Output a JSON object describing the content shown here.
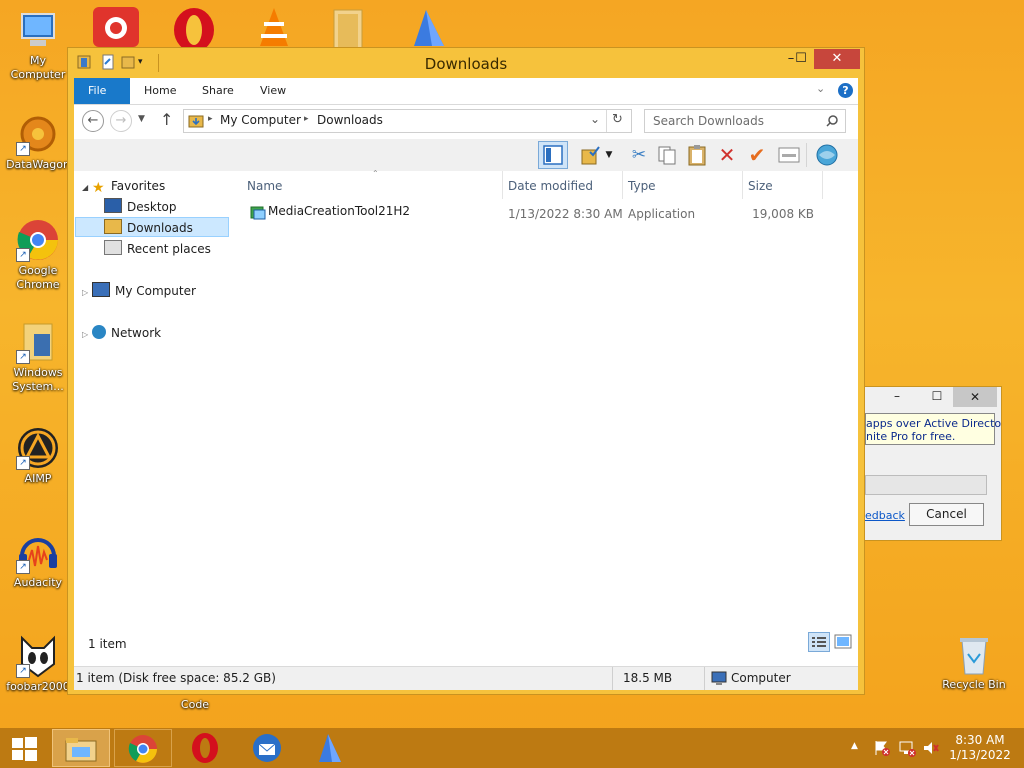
{
  "desktop": {
    "icons": [
      {
        "label": "My Computer",
        "icon": "my-computer-icon"
      },
      {
        "label": "DataWagon",
        "icon": "datawagon-icon"
      },
      {
        "label": "Google Chrome",
        "icon": "chrome-icon"
      },
      {
        "label": "Windows System...",
        "icon": "windows-system-icon"
      },
      {
        "label": "AIMP",
        "icon": "aimp-icon"
      },
      {
        "label": "Audacity",
        "icon": "audacity-icon"
      },
      {
        "label": "foobar2000",
        "icon": "foobar-icon"
      },
      {
        "label": "Code",
        "icon": "code-icon"
      },
      {
        "label": "Recycle Bin",
        "icon": "recycle-bin-icon"
      }
    ]
  },
  "window": {
    "title": "Downloads",
    "buttons": {
      "minimize": "–",
      "maximize": "☐",
      "close": "✕"
    },
    "ribbon": {
      "tabs": [
        "File",
        "Home",
        "Share",
        "View"
      ]
    },
    "address": {
      "segments": [
        "My Computer",
        "Downloads"
      ],
      "separator": "▸"
    },
    "search": {
      "placeholder": "Search Downloads"
    },
    "nav_pane": {
      "favorites": "Favorites",
      "desktop": "Desktop",
      "downloads": "Downloads",
      "recent": "Recent places",
      "computer": "My Computer",
      "network": "Network"
    },
    "columns": {
      "name": "Name",
      "date": "Date modified",
      "type": "Type",
      "size": "Size"
    },
    "files": [
      {
        "name": "MediaCreationTool21H2",
        "date": "1/13/2022 8:30 AM",
        "type": "Application",
        "size": "19,008 KB"
      }
    ],
    "status": {
      "count": "1 item"
    },
    "details": {
      "free_space": "1 item (Disk free space: 85.2 GB)",
      "size": "18.5 MB",
      "location": "Computer"
    }
  },
  "dialog": {
    "text_line1": "apps over Active Directory.",
    "text_line2": "nite Pro for free.",
    "link": "edback",
    "cancel": "Cancel"
  },
  "taskbar": {
    "clock_time": "8:30 AM",
    "clock_date": "1/13/2022",
    "show_hidden": "▲"
  },
  "colors": {
    "accent": "#1979ca",
    "window_frame": "#f6c23c",
    "taskbar": "#bd7a12"
  }
}
